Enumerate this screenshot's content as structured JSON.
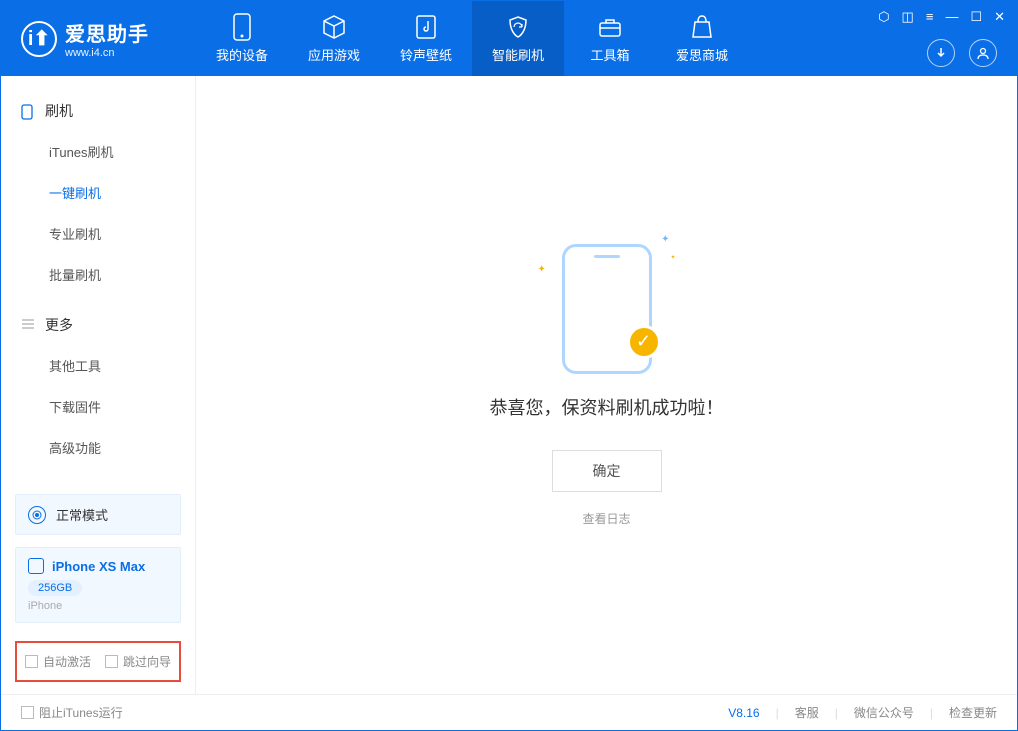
{
  "header": {
    "logo_title": "爱思助手",
    "logo_sub": "www.i4.cn",
    "tabs": [
      {
        "label": "我的设备"
      },
      {
        "label": "应用游戏"
      },
      {
        "label": "铃声壁纸"
      },
      {
        "label": "智能刷机"
      },
      {
        "label": "工具箱"
      },
      {
        "label": "爱思商城"
      }
    ]
  },
  "sidebar": {
    "section1": {
      "title": "刷机",
      "items": [
        "iTunes刷机",
        "一键刷机",
        "专业刷机",
        "批量刷机"
      ]
    },
    "section2": {
      "title": "更多",
      "items": [
        "其他工具",
        "下载固件",
        "高级功能"
      ]
    },
    "mode": "正常模式",
    "device": {
      "name": "iPhone XS Max",
      "capacity": "256GB",
      "type": "iPhone"
    },
    "checkboxes": {
      "auto_activate": "自动激活",
      "skip_guide": "跳过向导"
    }
  },
  "main": {
    "success_msg": "恭喜您，保资料刷机成功啦！",
    "ok_btn": "确定",
    "log_link": "查看日志"
  },
  "footer": {
    "block_itunes": "阻止iTunes运行",
    "version": "V8.16",
    "links": [
      "客服",
      "微信公众号",
      "检查更新"
    ]
  }
}
